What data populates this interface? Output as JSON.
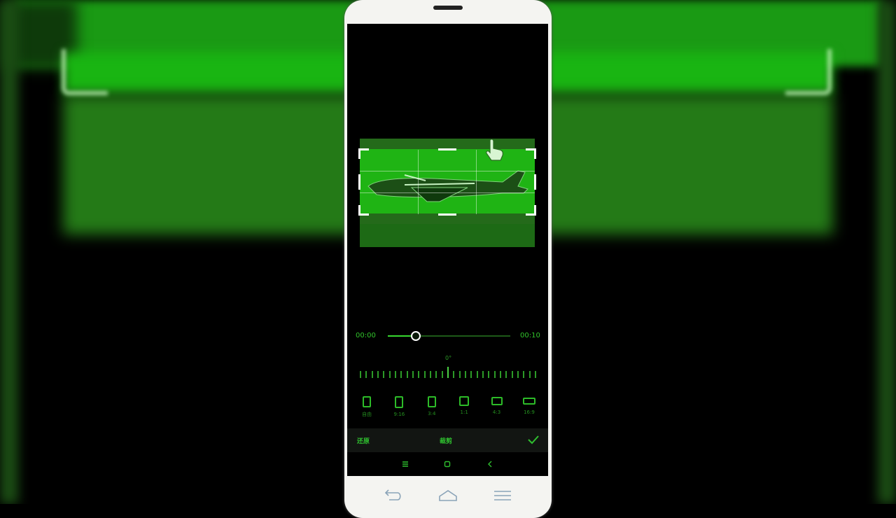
{
  "editor": {
    "time_start": "00:00",
    "time_end": "00:10",
    "progress_fraction": 0.22,
    "rotation_angle": "0°"
  },
  "ratios": [
    {
      "label": "自由",
      "icon": "free-ratio-icon"
    },
    {
      "label": "9:16",
      "icon": "ratio-9-16-icon"
    },
    {
      "label": "3:4",
      "icon": "ratio-3-4-icon"
    },
    {
      "label": "1:1",
      "icon": "ratio-1-1-icon"
    },
    {
      "label": "4:3",
      "icon": "ratio-4-3-icon"
    },
    {
      "label": "16:9",
      "icon": "ratio-16-9-icon"
    }
  ],
  "actions": {
    "left_label": "还原",
    "mid_label": "裁剪",
    "confirm_icon": "checkmark-icon"
  },
  "colors": {
    "accent": "#2fbf2f",
    "screen_bg": "#000000",
    "phone_body": "#f4f4f1"
  }
}
